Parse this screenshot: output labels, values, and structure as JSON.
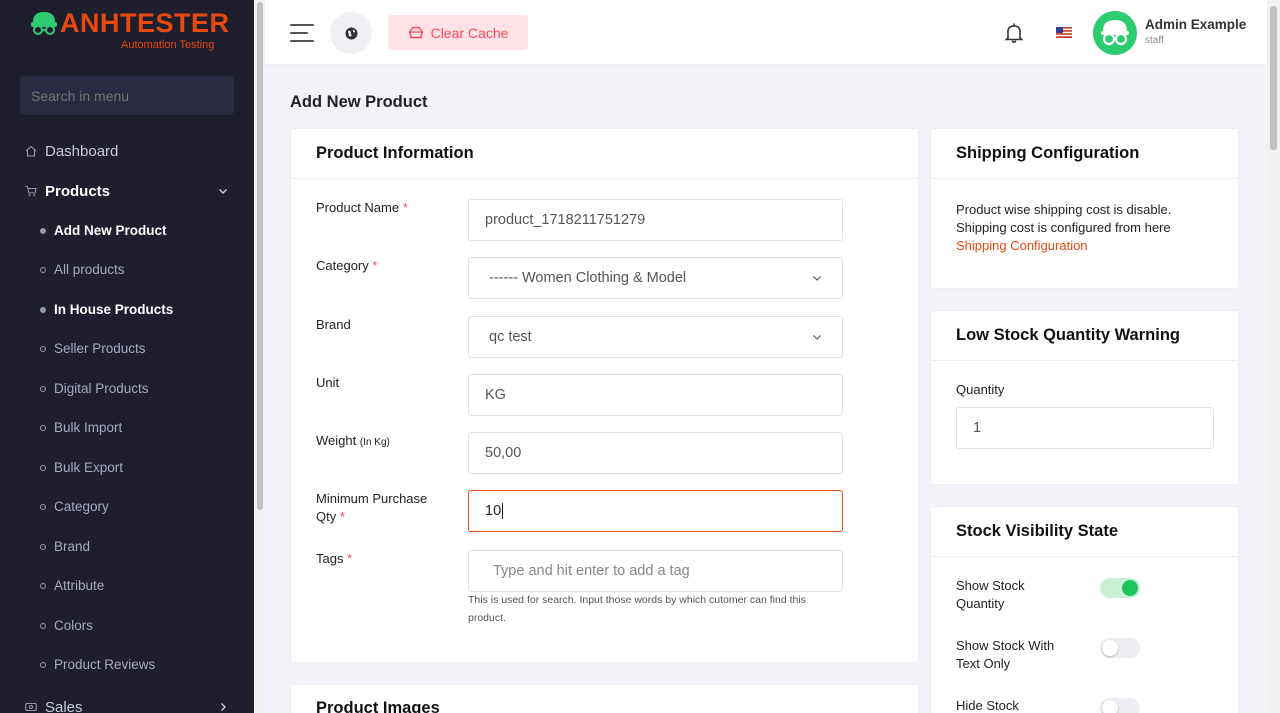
{
  "brand": {
    "name": "ANHTESTER",
    "tagline": "Automation Testing"
  },
  "sidebar": {
    "search_placeholder": "Search in menu",
    "dashboard": "Dashboard",
    "products": "Products",
    "sales": "Sales",
    "product_items": [
      "Add New Product",
      "All products",
      "In House Products",
      "Seller Products",
      "Digital Products",
      "Bulk Import",
      "Bulk Export",
      "Category",
      "Brand",
      "Attribute",
      "Colors",
      "Product Reviews"
    ]
  },
  "header": {
    "clear_cache": "Clear Cache",
    "user_name": "Admin Example",
    "user_role": "staff"
  },
  "page": {
    "title": "Add New Product"
  },
  "product_info": {
    "title": "Product Information",
    "name_label": "Product Name",
    "name_value": "product_1718211751279",
    "category_label": "Category",
    "category_value": "------ Women Clothing & Model",
    "brand_label": "Brand",
    "brand_value": "qc test",
    "unit_label": "Unit",
    "unit_value": "KG",
    "weight_label": "Weight",
    "weight_unit": "(In Kg)",
    "weight_value": "50,00",
    "min_qty_label_1": "Minimum Purchase",
    "min_qty_label_2": "Qty",
    "min_qty_value": "10",
    "tags_label": "Tags",
    "tags_placeholder": "Type and hit enter to add a tag",
    "tags_help": "This is used for search. Input those words by which cutomer can find this product.",
    "required_mark": "*"
  },
  "product_images": {
    "title": "Product Images"
  },
  "shipping": {
    "title": "Shipping Configuration",
    "line1": "Product wise shipping cost is disable.",
    "line2": "Shipping cost is configured from here",
    "link": "Shipping Configuration"
  },
  "low_stock": {
    "title": "Low Stock Quantity Warning",
    "quantity_label": "Quantity",
    "quantity_value": "1"
  },
  "stock_visibility": {
    "title": "Stock Visibility State",
    "options": [
      {
        "label": "Show Stock Quantity",
        "on": true
      },
      {
        "label": "Show Stock With Text Only",
        "on": false
      },
      {
        "label": "Hide Stock",
        "on": false
      }
    ]
  },
  "colors": {
    "accent": "#e8490f",
    "sidebar_bg": "#1e1e2d",
    "toggle_on": "#1bc55b",
    "danger": "#f64e60"
  }
}
